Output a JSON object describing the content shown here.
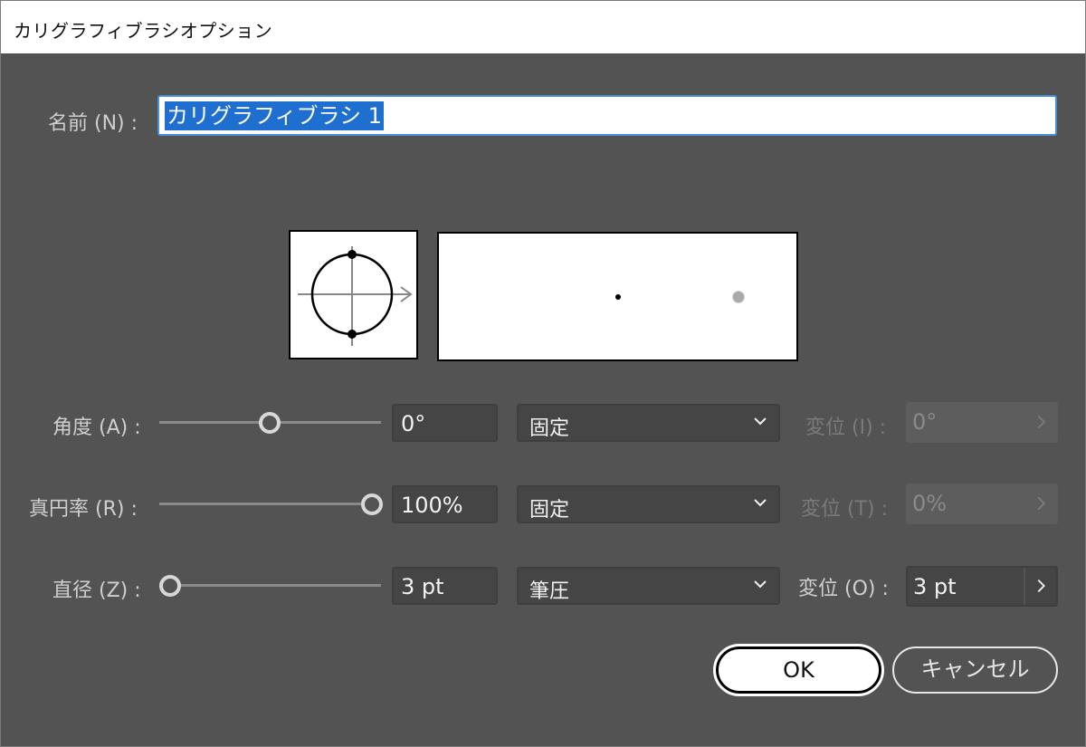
{
  "window": {
    "title": "カリグラフィブラシオプション"
  },
  "name": {
    "label": "名前 (N) :",
    "value": "カリグラフィブラシ 1"
  },
  "rows": [
    {
      "id": "angle",
      "label": "角度 (A) :",
      "value": "0°",
      "mode": "固定",
      "variation_label": "変位 (I) :",
      "variation_value": "0°",
      "variation_enabled": false,
      "slider_fraction": 0.5
    },
    {
      "id": "roundness",
      "label": "真円率 (R) :",
      "value": "100%",
      "mode": "固定",
      "variation_label": "変位 (T) :",
      "variation_value": "0%",
      "variation_enabled": false,
      "slider_fraction": 1.0
    },
    {
      "id": "diameter",
      "label": "直径 (Z) :",
      "value": "3 pt",
      "mode": "筆圧",
      "variation_label": "変位 (O) :",
      "variation_value": "3 pt",
      "variation_enabled": true,
      "slider_fraction": 0.0
    }
  ],
  "buttons": {
    "ok": "OK",
    "cancel": "キャンセル"
  },
  "icons": {
    "dropdown": "chevron-down-icon",
    "step": "chevron-right-icon"
  }
}
